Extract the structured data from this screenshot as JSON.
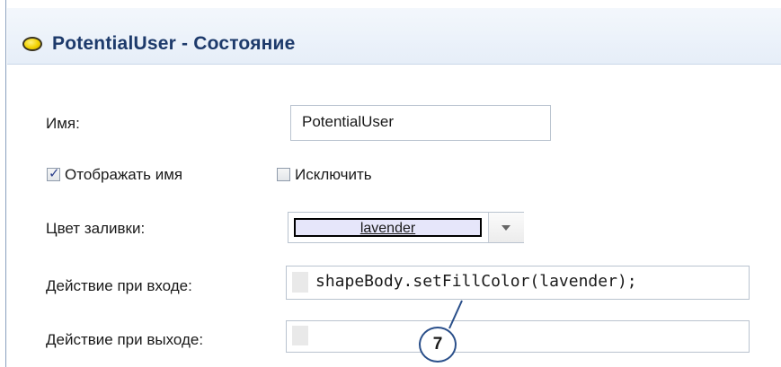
{
  "window": {
    "title": "PotentialUser - Состояние",
    "state_icon": "yellow-ellipse-state-icon"
  },
  "form": {
    "name_label": "Имя:",
    "name_value": "PotentialUser",
    "show_name_label": "Отображать имя",
    "show_name_checked": true,
    "exclude_label": "Исключить",
    "exclude_checked": false,
    "fill_color_label": "Цвет заливки:",
    "fill_color_value": "lavender",
    "fill_color_hex": "#E6E6FA",
    "entry_action_label": "Действие при входе:",
    "entry_action_code": "shapeBody.setFillColor(lavender);",
    "exit_action_label": "Действие при выходе:",
    "exit_action_code": ""
  },
  "annotation": {
    "callout_number": "7"
  }
}
